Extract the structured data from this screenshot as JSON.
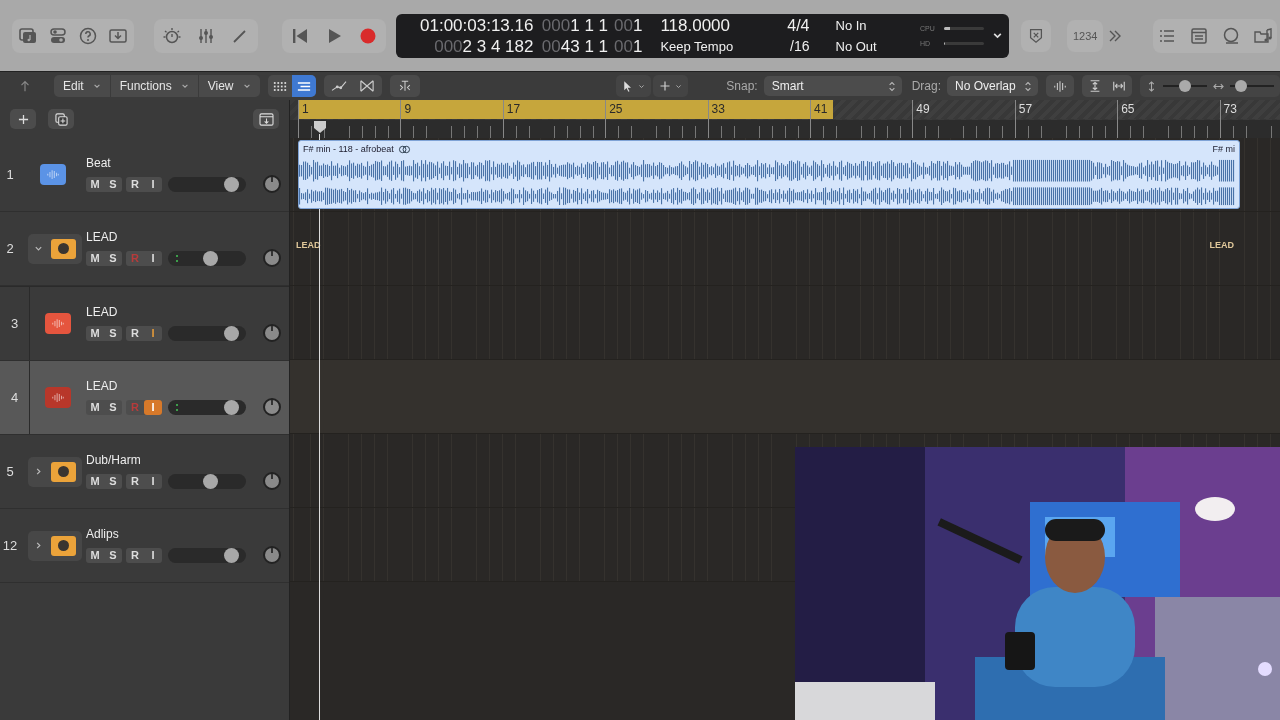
{
  "control_bar": {
    "lcd": {
      "columns": [
        {
          "top": {
            "text": "01:00:03:13.16"
          },
          "bottom": {
            "dim": "000",
            "text": "2 3 4 182"
          }
        },
        {
          "top": {
            "dim": "000",
            "text": "1 1 1"
          },
          "bottom": {
            "dim": "00",
            "text": "43 1 1"
          }
        },
        {
          "top": {
            "dim": "00",
            "text": "1"
          },
          "bottom": {
            "dim": "00",
            "text": "1"
          }
        },
        {
          "top": {
            "text": "118.0000"
          },
          "bottom": {
            "text": "Keep Tempo"
          }
        },
        {
          "top": {
            "text": "4/4"
          },
          "bottom": {
            "text": "/16"
          }
        },
        {
          "top": {
            "text": "No In"
          },
          "bottom": {
            "text": "No Out"
          }
        }
      ],
      "meters": [
        {
          "label": "CPU",
          "level": 0.15
        },
        {
          "label": "HD",
          "level": 0.03
        }
      ]
    },
    "count_in": "1234"
  },
  "toolbar": {
    "menus": [
      "Edit",
      "Functions",
      "View"
    ],
    "view_toggles": [
      {
        "selected": false
      },
      {
        "selected": true
      }
    ],
    "snap": {
      "label": "Snap:",
      "value": "Smart"
    },
    "drag": {
      "label": "Drag:",
      "value": "No Overlap"
    },
    "zoom_sliders": [
      {
        "level": 0.5
      },
      {
        "level": 0.15
      }
    ]
  },
  "ruler": {
    "cycle": {
      "level": 0.545
    },
    "bars": [
      "1",
      "9",
      "17",
      "25",
      "33",
      "41",
      "49",
      "57",
      "65",
      "73"
    ]
  },
  "tracks": [
    {
      "number": "1",
      "name": "Beat",
      "kind": "audio",
      "color": "#5b93e6",
      "selected": false,
      "controls": [
        "M",
        "S",
        "R",
        "I"
      ],
      "record_enabled": false,
      "input_enabled": false,
      "input_monitoring": false,
      "meter": false,
      "level": 0.82,
      "lane": {
        "region": {
          "title": "F# min - 118 - afrobeat",
          "tail": "F# mi",
          "looped": true
        }
      }
    },
    {
      "number": "2",
      "name": "LEAD",
      "kind": "stack",
      "expanded": true,
      "selected": false,
      "controls": [
        "M",
        "S",
        "R",
        "I"
      ],
      "record_enabled": true,
      "input_enabled": false,
      "input_monitoring": false,
      "meter": true,
      "level": 0.55,
      "lane": {
        "labels": [
          "LEAD",
          "LEAD"
        ]
      },
      "children": [
        {
          "number": "3",
          "name": "LEAD",
          "kind": "audio",
          "color": "#e5553e",
          "selected": false,
          "controls": [
            "M",
            "S",
            "R",
            "I"
          ],
          "record_enabled": false,
          "input_enabled": true,
          "input_monitoring": false,
          "meter": false,
          "level": 0.82
        },
        {
          "number": "4",
          "name": "LEAD",
          "kind": "audio",
          "color": "#b8372a",
          "selected": true,
          "controls": [
            "M",
            "S",
            "R",
            "I"
          ],
          "record_enabled": true,
          "input_enabled": true,
          "input_monitoring": true,
          "meter": true,
          "level": 0.82
        }
      ]
    },
    {
      "number": "5",
      "name": "Dub/Harm",
      "kind": "stack",
      "expanded": false,
      "selected": false,
      "controls": [
        "M",
        "S",
        "R",
        "I"
      ],
      "record_enabled": false,
      "input_enabled": false,
      "input_monitoring": false,
      "meter": false,
      "level": 0.55
    },
    {
      "number": "12",
      "name": "Adlips",
      "kind": "stack",
      "expanded": false,
      "selected": false,
      "controls": [
        "M",
        "S",
        "R",
        "I"
      ],
      "record_enabled": false,
      "input_enabled": false,
      "input_monitoring": false,
      "meter": false,
      "level": 0.82
    }
  ]
}
